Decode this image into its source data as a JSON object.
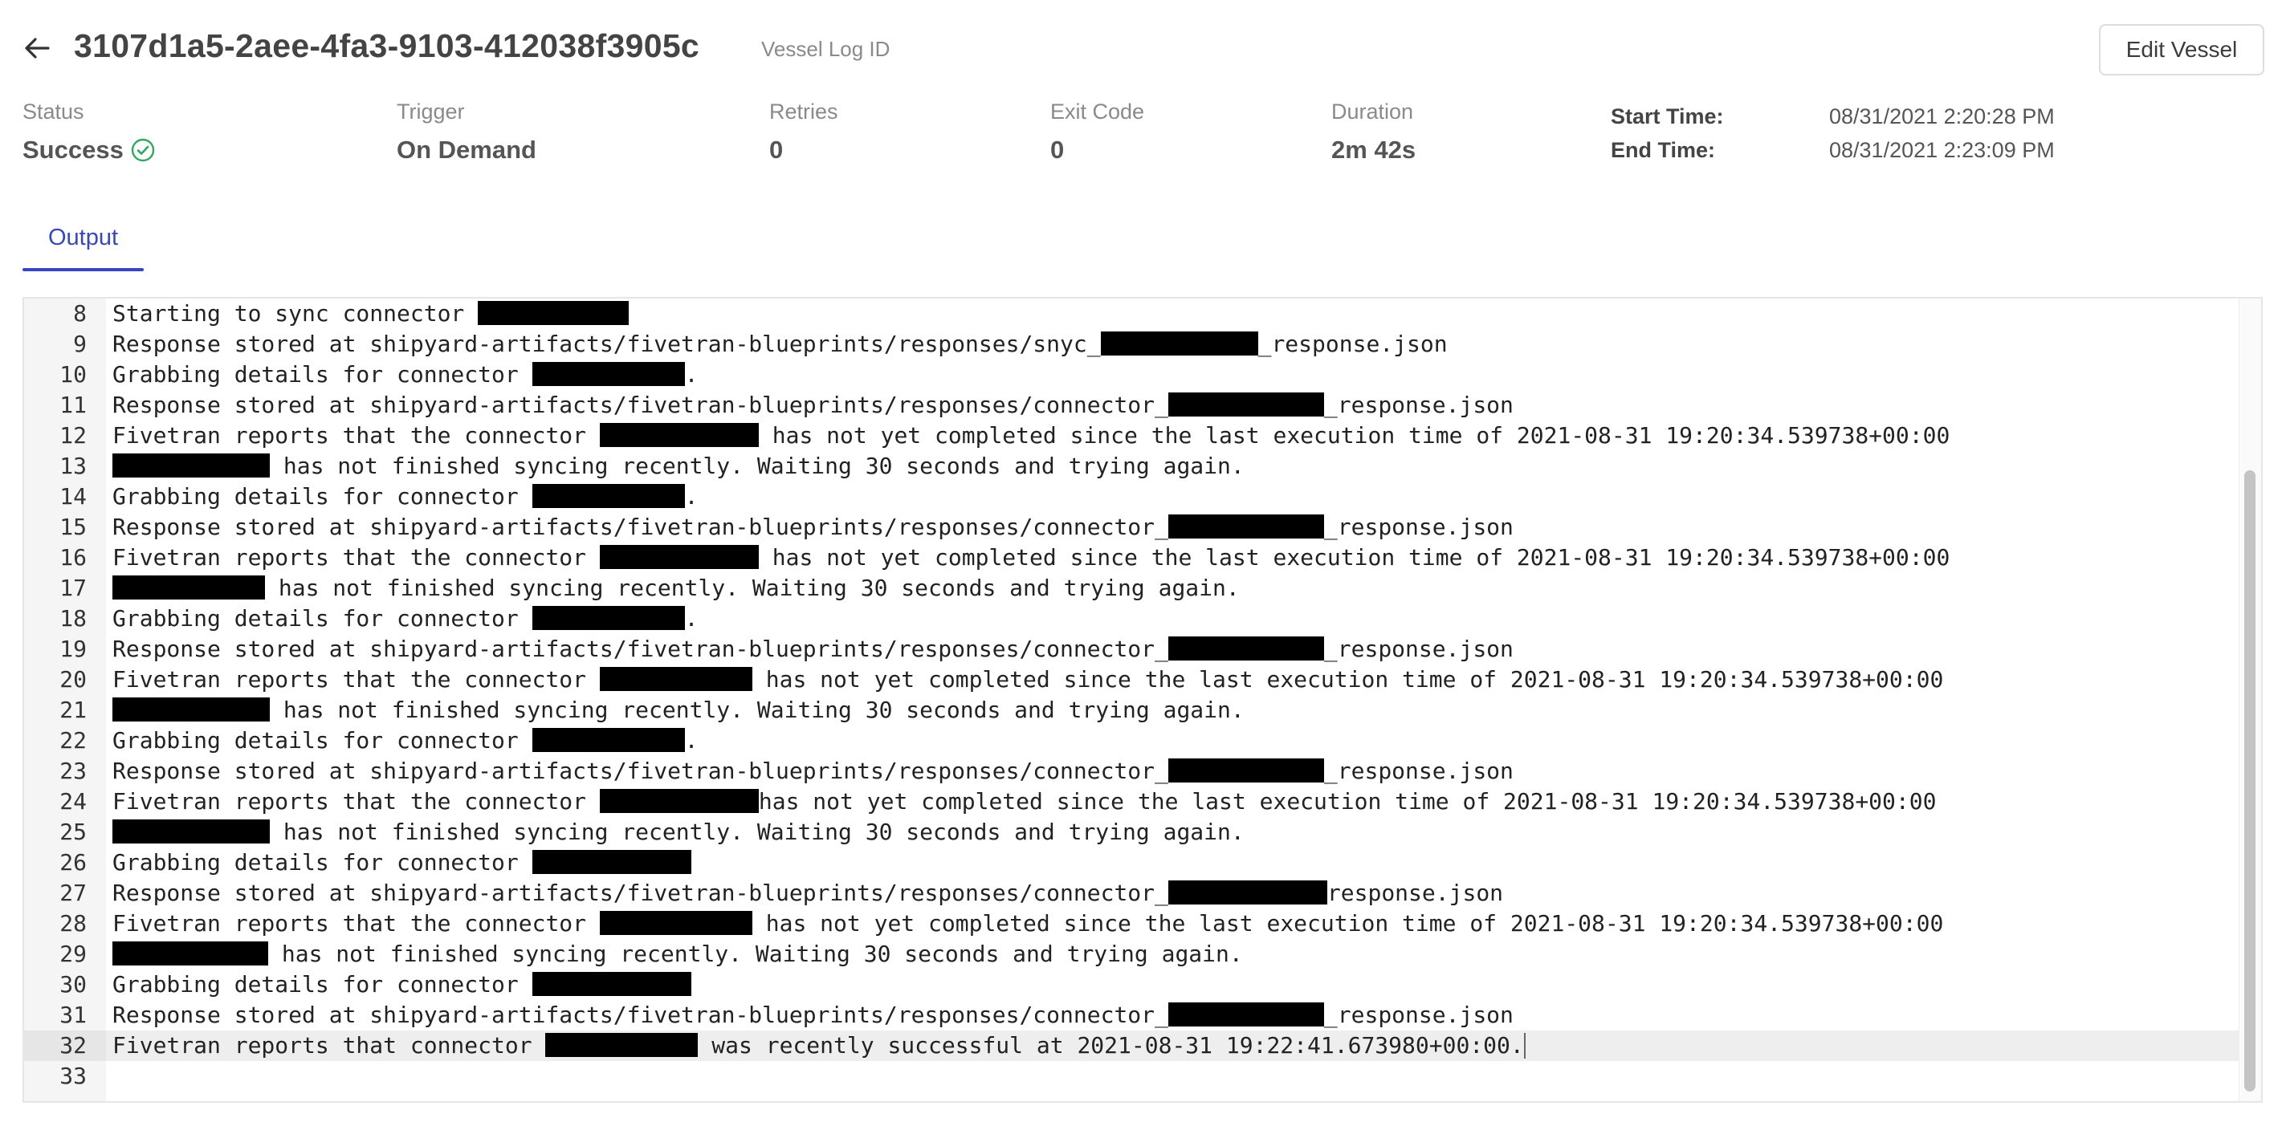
{
  "header": {
    "back_icon": "arrow-left-icon",
    "title": "3107d1a5-2aee-4fa3-9103-412038f3905c",
    "subtitle": "Vessel Log ID",
    "edit_button": "Edit Vessel"
  },
  "stats": {
    "status": {
      "label": "Status",
      "value": "Success",
      "icon": "check-circle-icon",
      "color": "#2eaa5c"
    },
    "trigger": {
      "label": "Trigger",
      "value": "On Demand"
    },
    "retries": {
      "label": "Retries",
      "value": "0"
    },
    "exit_code": {
      "label": "Exit Code",
      "value": "0"
    },
    "duration": {
      "label": "Duration",
      "value": "2m 42s"
    },
    "start_time": {
      "label": "Start Time:",
      "value": "08/31/2021 2:20:28 PM"
    },
    "end_time": {
      "label": "End Time:",
      "value": "08/31/2021 2:23:09 PM"
    }
  },
  "tabs": [
    {
      "label": "Output",
      "active": true
    }
  ],
  "colors": {
    "accent": "#3846c4",
    "success": "#2eaa5c"
  },
  "log": {
    "active_line": 32,
    "lines": [
      {
        "n": "8",
        "parts": [
          {
            "t": "Starting to sync connector "
          },
          {
            "r": 188
          }
        ]
      },
      {
        "n": "9",
        "parts": [
          {
            "t": "Response stored at shipyard-artifacts/fivetran-blueprints/responses/snyc_"
          },
          {
            "r": 196
          },
          {
            "t": "_response.json"
          }
        ]
      },
      {
        "n": "10",
        "parts": [
          {
            "t": "Grabbing details for connector "
          },
          {
            "r": 190
          },
          {
            "t": "."
          }
        ]
      },
      {
        "n": "11",
        "parts": [
          {
            "t": "Response stored at shipyard-artifacts/fivetran-blueprints/responses/connector_"
          },
          {
            "r": 194
          },
          {
            "t": "_response.json"
          }
        ]
      },
      {
        "n": "12",
        "parts": [
          {
            "t": "Fivetran reports that the connector "
          },
          {
            "r": 198
          },
          {
            "t": " has not yet completed since the last execution time of 2021-08-31 19:20:34.539738+00:00"
          }
        ]
      },
      {
        "n": "13",
        "parts": [
          {
            "r": 196
          },
          {
            "t": " has not finished syncing recently. Waiting 30 seconds and trying again."
          }
        ]
      },
      {
        "n": "14",
        "parts": [
          {
            "t": "Grabbing details for connector "
          },
          {
            "r": 190
          },
          {
            "t": "."
          }
        ]
      },
      {
        "n": "15",
        "parts": [
          {
            "t": "Response stored at shipyard-artifacts/fivetran-blueprints/responses/connector_"
          },
          {
            "r": 194
          },
          {
            "t": "_response.json"
          }
        ]
      },
      {
        "n": "16",
        "parts": [
          {
            "t": "Fivetran reports that the connector "
          },
          {
            "r": 198
          },
          {
            "t": " has not yet completed since the last execution time of 2021-08-31 19:20:34.539738+00:00"
          }
        ]
      },
      {
        "n": "17",
        "parts": [
          {
            "r": 190
          },
          {
            "t": " has not finished syncing recently. Waiting 30 seconds and trying again."
          }
        ]
      },
      {
        "n": "18",
        "parts": [
          {
            "t": "Grabbing details for connector "
          },
          {
            "r": 190
          },
          {
            "t": "."
          }
        ]
      },
      {
        "n": "19",
        "parts": [
          {
            "t": "Response stored at shipyard-artifacts/fivetran-blueprints/responses/connector_"
          },
          {
            "r": 194
          },
          {
            "t": "_response.json"
          }
        ]
      },
      {
        "n": "20",
        "parts": [
          {
            "t": "Fivetran reports that the connector "
          },
          {
            "r": 190
          },
          {
            "t": " has not yet completed since the last execution time of 2021-08-31 19:20:34.539738+00:00"
          }
        ]
      },
      {
        "n": "21",
        "parts": [
          {
            "r": 196
          },
          {
            "t": " has not finished syncing recently. Waiting 30 seconds and trying again."
          }
        ]
      },
      {
        "n": "22",
        "parts": [
          {
            "t": "Grabbing details for connector "
          },
          {
            "r": 190
          },
          {
            "t": "."
          }
        ]
      },
      {
        "n": "23",
        "parts": [
          {
            "t": "Response stored at shipyard-artifacts/fivetran-blueprints/responses/connector_"
          },
          {
            "r": 194
          },
          {
            "t": "_response.json"
          }
        ]
      },
      {
        "n": "24",
        "parts": [
          {
            "t": "Fivetran reports that the connector "
          },
          {
            "r": 198
          },
          {
            "t": "has not yet completed since the last execution time of 2021-08-31 19:20:34.539738+00:00"
          }
        ]
      },
      {
        "n": "25",
        "parts": [
          {
            "r": 196
          },
          {
            "t": " has not finished syncing recently. Waiting 30 seconds and trying again."
          }
        ]
      },
      {
        "n": "26",
        "parts": [
          {
            "t": "Grabbing details for connector "
          },
          {
            "r": 198
          }
        ]
      },
      {
        "n": "27",
        "parts": [
          {
            "t": "Response stored at shipyard-artifacts/fivetran-blueprints/responses/connector_"
          },
          {
            "r": 198
          },
          {
            "t": "response.json"
          }
        ]
      },
      {
        "n": "28",
        "parts": [
          {
            "t": "Fivetran reports that the connector "
          },
          {
            "r": 190
          },
          {
            "t": " has not yet completed since the last execution time of 2021-08-31 19:20:34.539738+00:00"
          }
        ]
      },
      {
        "n": "29",
        "parts": [
          {
            "r": 194
          },
          {
            "t": " has not finished syncing recently. Waiting 30 seconds and trying again."
          }
        ]
      },
      {
        "n": "30",
        "parts": [
          {
            "t": "Grabbing details for connector "
          },
          {
            "r": 198
          }
        ]
      },
      {
        "n": "31",
        "parts": [
          {
            "t": "Response stored at shipyard-artifacts/fivetran-blueprints/responses/connector_"
          },
          {
            "r": 194
          },
          {
            "t": "_response.json"
          }
        ]
      },
      {
        "n": "32",
        "parts": [
          {
            "t": "Fivetran reports that connector "
          },
          {
            "r": 190
          },
          {
            "t": " was recently successful at 2021-08-31 19:22:41.673980+00:00."
          }
        ]
      },
      {
        "n": "33",
        "parts": []
      }
    ]
  }
}
